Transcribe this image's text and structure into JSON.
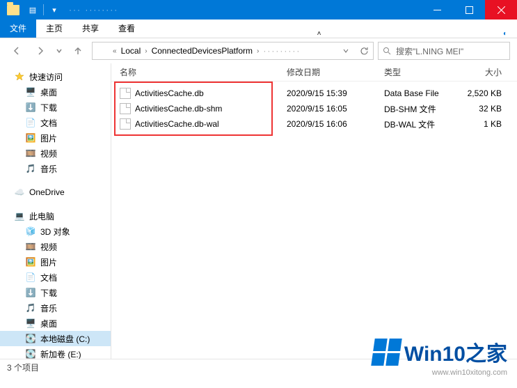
{
  "titlebar": {
    "title_obscured": "··· ········"
  },
  "ribbon": {
    "file": "文件",
    "home": "主页",
    "share": "共享",
    "view": "查看"
  },
  "breadcrumb": {
    "parts": [
      "Local",
      "ConnectedDevicesPlatform"
    ],
    "obscured_tail": "·········"
  },
  "search": {
    "placeholder": "搜索\"L.NING MEI\""
  },
  "columns": {
    "name": "名称",
    "date": "修改日期",
    "type": "类型",
    "size": "大小"
  },
  "files": [
    {
      "name": "ActivitiesCache.db",
      "date": "2020/9/15 15:39",
      "type": "Data Base File",
      "size": "2,520 KB"
    },
    {
      "name": "ActivitiesCache.db-shm",
      "date": "2020/9/15 16:05",
      "type": "DB-SHM 文件",
      "size": "32 KB"
    },
    {
      "name": "ActivitiesCache.db-wal",
      "date": "2020/9/15 16:06",
      "type": "DB-WAL 文件",
      "size": "1 KB"
    }
  ],
  "sidebar": {
    "quick": "快速访问",
    "quick_items": [
      "桌面",
      "下载",
      "文档",
      "图片",
      "视频",
      "音乐"
    ],
    "onedrive": "OneDrive",
    "thispc": "此电脑",
    "pc_items": [
      "3D 对象",
      "视频",
      "图片",
      "文档",
      "下载",
      "音乐",
      "桌面",
      "本地磁盘 (C:)",
      "新加卷 (E:)"
    ]
  },
  "status": {
    "count": "3 个项目"
  },
  "watermark": {
    "brand_a": "Win10",
    "brand_b": "之家",
    "url": "www.win10xitong.com"
  }
}
